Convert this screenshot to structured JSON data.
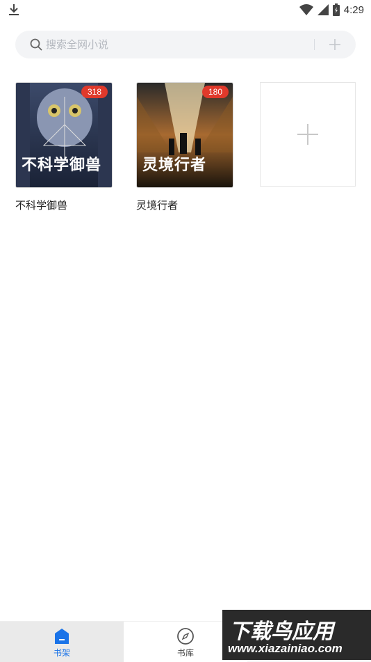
{
  "status_bar": {
    "time": "4:29",
    "icons": [
      "download-icon",
      "wifi-icon",
      "signal-icon",
      "battery-icon"
    ]
  },
  "search": {
    "placeholder": "搜索全网小说",
    "add_icon": "plus-icon"
  },
  "books": [
    {
      "title": "不科学御兽",
      "badge": "318",
      "cover_text": "不科学御兽"
    },
    {
      "title": "灵境行者",
      "badge": "180",
      "cover_text": "灵境行者"
    }
  ],
  "add_book": {
    "icon": "plus-icon"
  },
  "bottom_nav": {
    "tabs": [
      {
        "label": "书架",
        "icon": "bookshelf-icon",
        "active": true
      },
      {
        "label": "书库",
        "icon": "compass-icon",
        "active": false
      }
    ]
  },
  "watermark": {
    "line1": "下载鸟应用",
    "line2": "www.xiazainiao.com"
  },
  "colors": {
    "accent": "#1a73e8",
    "badge": "#e0392b",
    "search_bg": "#f3f4f6"
  }
}
